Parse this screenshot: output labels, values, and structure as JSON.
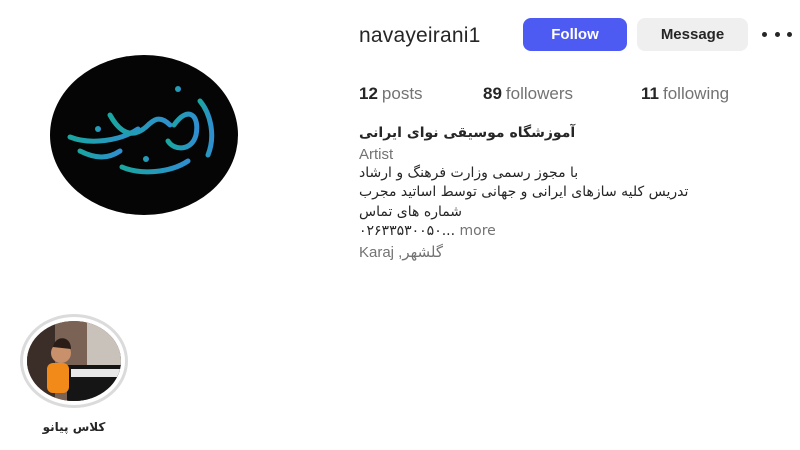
{
  "profile": {
    "username": "navayeirani1",
    "follow_label": "Follow",
    "message_label": "Message",
    "more_options_icon": "more-horizontal-icon",
    "avatar_logo_text": "نوای ایرانی",
    "colors": {
      "follow": "#4e5bf2",
      "message_bg": "#efefef",
      "logo": "#1fa8a8"
    }
  },
  "stats": {
    "posts": {
      "count": "12",
      "label": "posts"
    },
    "followers": {
      "count": "89",
      "label": "followers"
    },
    "following": {
      "count": "11",
      "label": "following"
    }
  },
  "bio": {
    "name": "آموزشگاه موسیقی نوای ایرانی",
    "category": "Artist",
    "lines": [
      "با مجوز رسمی وزارت فرهنگ و ارشاد",
      "تدریس کلیه سازهای ایرانی و جهانی توسط اساتید مجرب",
      "شماره های تماس",
      "۰۲۶۳۳۵۳۰۰۵۰..."
    ],
    "more_label": " more",
    "location": "Karaj ,گلشهر"
  },
  "highlights": [
    {
      "label": "کلاس پیانو"
    }
  ]
}
